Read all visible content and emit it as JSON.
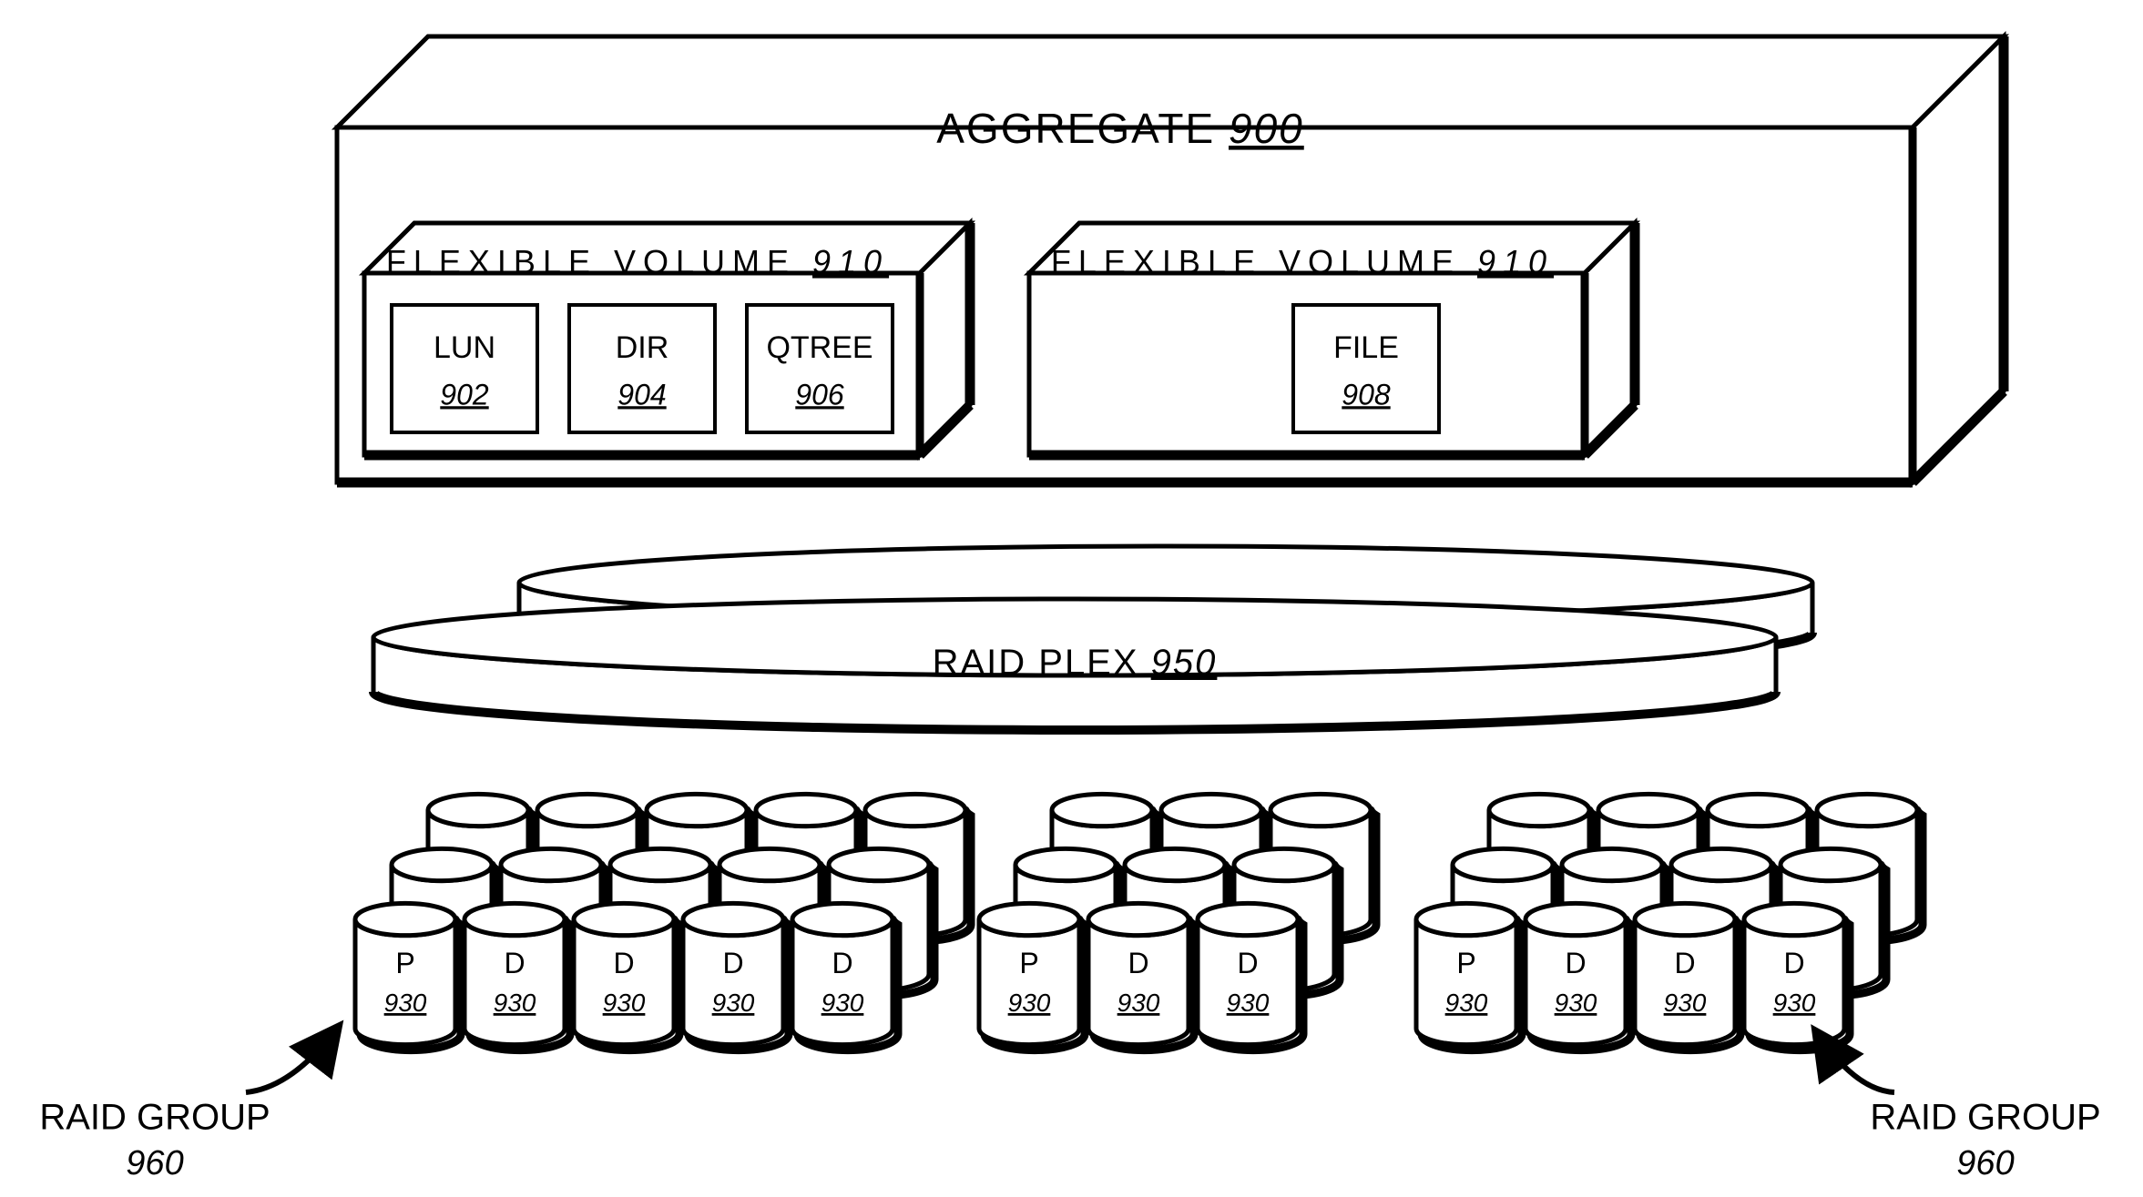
{
  "aggregate": {
    "label": "AGGREGATE",
    "ref": "900"
  },
  "flex1": {
    "label": "FLEXIBLE VOLUME",
    "ref": "910"
  },
  "flex2": {
    "label": "FLEXIBLE VOLUME",
    "ref": "910"
  },
  "lun": {
    "label": "LUN",
    "ref": "902"
  },
  "dir": {
    "label": "DIR",
    "ref": "904"
  },
  "qtree": {
    "label": "QTREE",
    "ref": "906"
  },
  "file": {
    "label": "FILE",
    "ref": "908"
  },
  "plex": {
    "label": "RAID PLEX",
    "ref": "950"
  },
  "disk_ref": "930",
  "rg": {
    "label": "RAID GROUP",
    "ref": "960"
  },
  "groups": [
    {
      "labels": [
        "P",
        "D",
        "D",
        "D",
        "D"
      ]
    },
    {
      "labels": [
        "P",
        "D",
        "D"
      ]
    },
    {
      "labels": [
        "P",
        "D",
        "D",
        "D"
      ]
    }
  ]
}
